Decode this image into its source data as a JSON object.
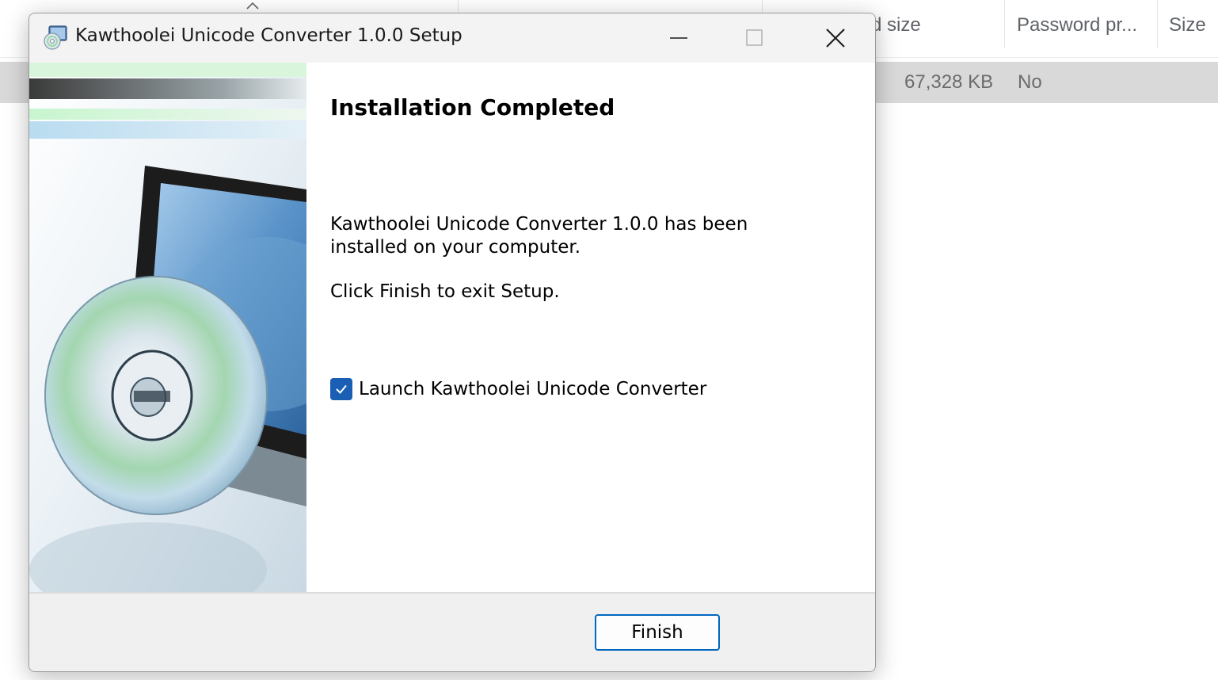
{
  "explorer": {
    "columns": [
      {
        "label": "d size"
      },
      {
        "label": "Password pr..."
      },
      {
        "label": "Size"
      }
    ],
    "row": {
      "compressed_size": "67,328 KB",
      "password_protected": "No"
    }
  },
  "dialog": {
    "title": "Kawthoolei Unicode Converter 1.0.0 Setup",
    "heading": "Installation Completed",
    "message_line1": "Kawthoolei Unicode Converter 1.0.0 has been",
    "message_line2": "installed on your computer.",
    "message_exit": "Click Finish to exit Setup.",
    "launch_checkbox": {
      "label": "Launch Kawthoolei Unicode Converter",
      "checked": true
    },
    "finish_label": "Finish"
  },
  "colors": {
    "checkbox_accent": "#1a5fb4",
    "button_border": "#0067c0",
    "selected_row": "#d9d9d9"
  }
}
